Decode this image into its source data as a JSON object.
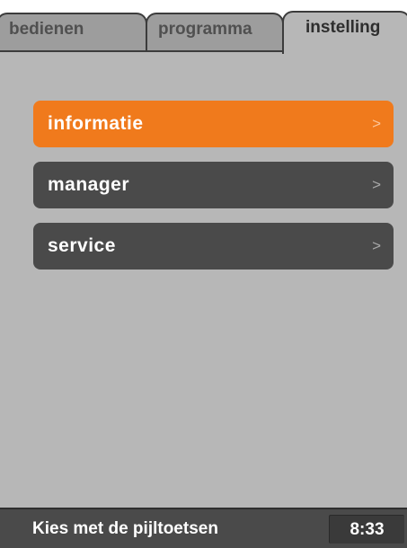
{
  "tabs": [
    {
      "label": "bedienen",
      "active": false
    },
    {
      "label": "programma",
      "active": false
    },
    {
      "label": "instelling",
      "active": true
    }
  ],
  "menu": {
    "items": [
      {
        "label": "informatie",
        "arrow": ">",
        "selected": true
      },
      {
        "label": "manager",
        "arrow": ">",
        "selected": false
      },
      {
        "label": "service",
        "arrow": ">",
        "selected": false
      }
    ]
  },
  "status": {
    "hint": "Kies met de pijltoetsen",
    "time": "8:33"
  },
  "colors": {
    "background": "#b7b7b7",
    "item": "#4a4a4a",
    "selected": "#f07a1c",
    "text": "#ffffff"
  }
}
